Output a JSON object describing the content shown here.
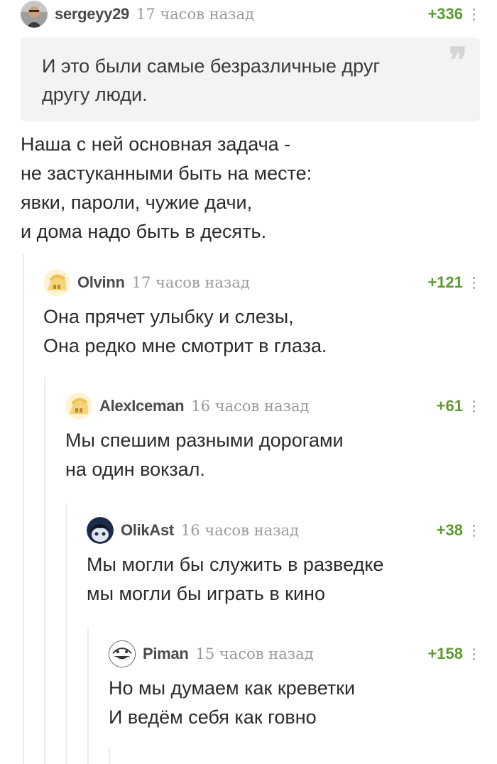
{
  "comments": [
    {
      "username": "sergeyy29",
      "time": "17 часов назад",
      "rating": "+336",
      "avatar_icon": "photo-avatar-icon",
      "quote_lines": [
        "И это были самые безразличные друг",
        "другу люди."
      ],
      "lines": [
        "Наша с ней основная задача -",
        "не застуканными быть на месте:",
        "явки, пароли, чужие дачи,",
        "и дома надо быть в десять."
      ]
    },
    {
      "username": "Olvinn",
      "time": "17 часов назад",
      "rating": "+121",
      "avatar_icon": "default-avatar-icon",
      "lines": [
        "Она прячет улыбку и слезы,",
        "Она редко мне смотрит в глаза."
      ]
    },
    {
      "username": "AlexIceman",
      "time": "16 часов назад",
      "rating": "+61",
      "avatar_icon": "default-avatar-icon",
      "lines": [
        "Мы спешим разными дорогами",
        "на один вокзал."
      ]
    },
    {
      "username": "OlikAst",
      "time": "16 часов назад",
      "rating": "+38",
      "avatar_icon": "dark-face-avatar-icon",
      "lines": [
        "Мы могли бы служить в разведке",
        "мы могли бы играть в кино"
      ]
    },
    {
      "username": "Piman",
      "time": "15 часов назад",
      "rating": "+158",
      "avatar_icon": "trollface-avatar-icon",
      "lines": [
        "Но мы думаем как креветки",
        "И ведём себя как говно"
      ]
    }
  ],
  "quote_icon": "quote-icon",
  "more_icon": "more-vertical-icon",
  "colors": {
    "rating": "#5d9b32",
    "thread_line": "#ececec",
    "quote_bg": "#f3f3f3"
  }
}
